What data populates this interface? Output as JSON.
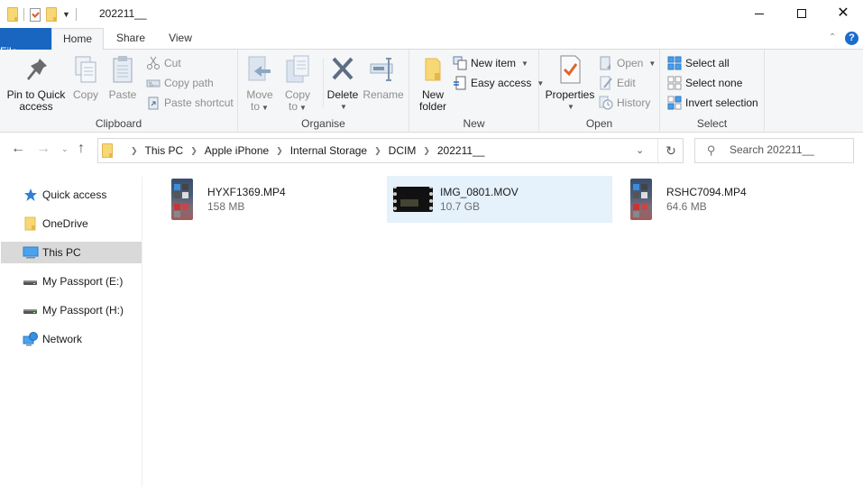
{
  "window": {
    "title": "202211__",
    "controls": {
      "minimize": "minimize",
      "maximize": "maximize",
      "close": "close"
    }
  },
  "quick_access_toolbar": {
    "icons": [
      "folder-icon",
      "properties-icon",
      "new-folder-icon",
      "customize-dropdown-icon"
    ]
  },
  "ribbon": {
    "tabs": [
      {
        "label": "File",
        "active": false
      },
      {
        "label": "Home",
        "active": true
      },
      {
        "label": "Share",
        "active": false
      },
      {
        "label": "View",
        "active": false
      }
    ],
    "groups": {
      "clipboard": {
        "label": "Clipboard",
        "pin": "Pin to Quick access",
        "pin_line1": "Pin to Quick",
        "pin_line2": "access",
        "copy": "Copy",
        "paste": "Paste",
        "cut": "Cut",
        "copy_path": "Copy path",
        "paste_shortcut": "Paste shortcut"
      },
      "organise": {
        "label": "Organise",
        "move_to_line1": "Move",
        "move_to_line2": "to",
        "copy_to_line1": "Copy",
        "copy_to_line2": "to",
        "delete": "Delete",
        "rename": "Rename"
      },
      "new": {
        "label": "New",
        "new_folder_line1": "New",
        "new_folder_line2": "folder",
        "new_item": "New item",
        "easy_access": "Easy access"
      },
      "open": {
        "label": "Open",
        "properties": "Properties",
        "open": "Open",
        "edit": "Edit",
        "history": "History"
      },
      "select": {
        "label": "Select",
        "select_all": "Select all",
        "select_none": "Select none",
        "invert_selection": "Invert selection"
      }
    }
  },
  "address_bar": {
    "breadcrumbs": [
      "This PC",
      "Apple iPhone",
      "Internal Storage",
      "DCIM",
      "202211__"
    ]
  },
  "search": {
    "placeholder": "Search 202211__"
  },
  "nav_pane": {
    "items": [
      {
        "label": "Quick access",
        "icon": "star-icon",
        "selected": false
      },
      {
        "label": "OneDrive",
        "icon": "folder-icon",
        "selected": false
      },
      {
        "label": "This PC",
        "icon": "computer-icon",
        "selected": true
      },
      {
        "label": "My Passport (E:)",
        "icon": "drive-icon",
        "selected": false
      },
      {
        "label": "My Passport (H:)",
        "icon": "drive-icon",
        "selected": false
      },
      {
        "label": "Network",
        "icon": "network-icon",
        "selected": false
      }
    ]
  },
  "files": [
    {
      "name": "HYXF1369.MP4",
      "size": "158 MB",
      "thumbnail": "phone-screenshot",
      "selected": false
    },
    {
      "name": "IMG_0801.MOV",
      "size": "10.7 GB",
      "thumbnail": "video-filmstrip",
      "selected": true
    },
    {
      "name": "RSHC7094.MP4",
      "size": "64.6 MB",
      "thumbnail": "phone-screenshot",
      "selected": false
    }
  ],
  "colors": {
    "file_tab": "#1966c0",
    "selection": "#e5f1fb",
    "nav_selected": "#d9d9d9",
    "ribbon_bg": "#f5f6f7"
  }
}
